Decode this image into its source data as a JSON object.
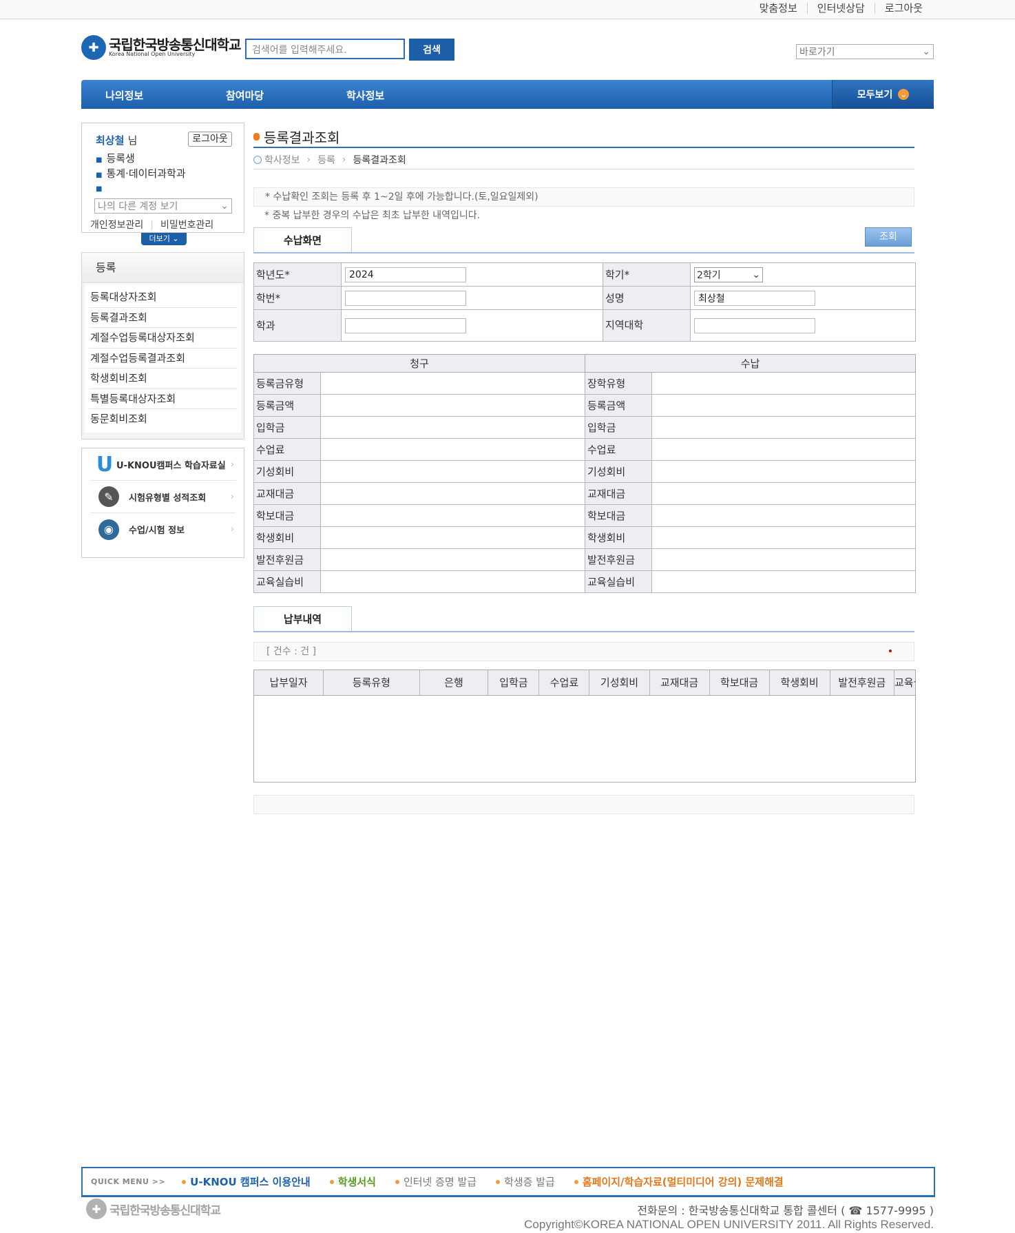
{
  "top_links": [
    "맞춤정보",
    "인터넷상담",
    "로그아웃"
  ],
  "logo": {
    "korean": "국립한국방송통신대학교",
    "english": "Korea National Open University"
  },
  "search": {
    "placeholder": "검색어를 입력해주세요.",
    "button": "검색"
  },
  "quick_select": "바로가기",
  "nav": {
    "items": [
      "나의정보",
      "참여마당",
      "학사정보"
    ],
    "all": "모두보기"
  },
  "user": {
    "name": "최상철",
    "honorific": "님",
    "logout": "로그아웃",
    "status": "등록생",
    "dept": "통계·데이터과학과",
    "extra": "",
    "account_select": "나의 다른 계정 보기",
    "link_profile": "개인정보관리",
    "link_password": "비밀번호관리",
    "more": "더보기"
  },
  "submenu": {
    "title": "등록",
    "items": [
      "등록대상자조회",
      "등록결과조회",
      "계절수업등록대상자조회",
      "계절수업등록결과조회",
      "학생회비조회",
      "특별등록대상자조회",
      "동문회비조회"
    ]
  },
  "banners": [
    {
      "label": "U-KNOU캠퍼스 학습자료실",
      "icon": "u-campus-icon"
    },
    {
      "label": "시험유형별 성적조회",
      "icon": "exam-icon"
    },
    {
      "label": "수업/시험 정보",
      "icon": "headset-icon"
    }
  ],
  "page": {
    "title": "등록결과조회",
    "breadcrumb": [
      "학사정보",
      "등록",
      "등록결과조회"
    ],
    "notice1": "* 수납확인 조회는 등록 후 1~2일 후에 가능합니다.(토,일요일제외)",
    "notice2": "* 중복 납부한 경우의 수납은 최초 납부한 내역입니다."
  },
  "tabs": {
    "payment": "수납화면",
    "history": "납부내역"
  },
  "query_button": "조회",
  "form": {
    "year_label": "학년도*",
    "year_value": "2024",
    "semester_label": "학기*",
    "semester_value": "2학기",
    "student_no_label": "학번*",
    "student_no_value": "",
    "name_label": "성명",
    "name_value": "최상철",
    "dept_label": "학과",
    "dept_value": "",
    "region_label": "지역대학",
    "region_value": ""
  },
  "bill": {
    "header_charge": "청구",
    "header_paid": "수납",
    "rows": [
      [
        "등록금유형",
        "장학유형"
      ],
      [
        "등록금액",
        "등록금액"
      ],
      [
        "입학금",
        "입학금"
      ],
      [
        "수업료",
        "수업료"
      ],
      [
        "기성회비",
        "기성회비"
      ],
      [
        "교재대금",
        "교재대금"
      ],
      [
        "학보대금",
        "학보대금"
      ],
      [
        "학생회비",
        "학생회비"
      ],
      [
        "발전후원금",
        "발전후원금"
      ],
      [
        "교육실습비",
        "교육실습비"
      ]
    ]
  },
  "history": {
    "count": "[ 건수 : 건 ]",
    "count_mark": "•",
    "columns": [
      "납부일자",
      "등록유형",
      "은행",
      "입학금",
      "수업료",
      "기성회비",
      "교재대금",
      "학보대금",
      "학생회비",
      "발전후원금",
      "교육실습비"
    ]
  },
  "quick_menu": {
    "label": "QUICK MENU  >>",
    "items": [
      {
        "text": "U-KNOU 캠퍼스 이용안내",
        "color": "#1c5fab"
      },
      {
        "text": "학생서식",
        "color": "#5a9a22"
      },
      {
        "text": "인터넷 증명 발급",
        "color": "#777777"
      },
      {
        "text": "학생증 발급",
        "color": "#777777"
      },
      {
        "text": "홈페이지/학습자료(멀티미디어 강의) 문제해결",
        "color": "#e0781c"
      }
    ]
  },
  "footer": {
    "contact": "전화문의 : 한국방송통신대학교 통합 콜센터 ( ☎ 1577-9995 )",
    "copyright": "Copyright©KOREA NATIONAL OPEN UNIVERSITY 2011. All Rights Reserved."
  }
}
